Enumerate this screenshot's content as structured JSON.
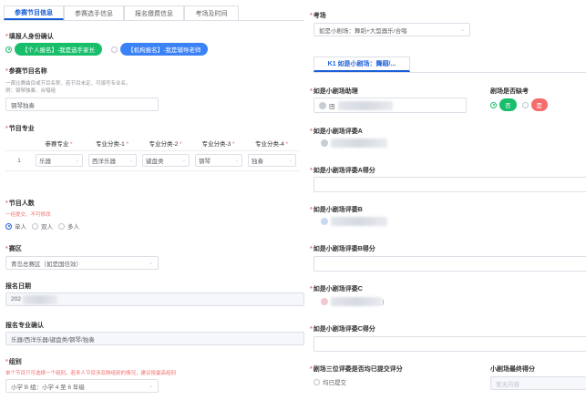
{
  "tabs": [
    {
      "label": "参赛节目信息",
      "active": true
    },
    {
      "label": "参赛选手信息"
    },
    {
      "label": "报名缴费信息"
    },
    {
      "label": "考场及时间"
    }
  ],
  "identity": {
    "label": "填报人身份确认",
    "options": [
      {
        "label": "【个人报名】-我是选手家长",
        "color": "#19be6b",
        "selected": true
      },
      {
        "label": "【机构报名】-我是辅导老师",
        "color": "#3b82f6",
        "selected": false
      }
    ]
  },
  "program_name": {
    "label": "参赛节目名称",
    "hint1": "一首比赛曲目或节目名称、若节目未定、可填写专业名。",
    "hint2": "例：钢琴独奏、合唱组",
    "value": "钢琴独奏"
  },
  "major": {
    "label": "节目专业",
    "columns": [
      "参赛专业",
      "专业分类-1",
      "专业分类-2",
      "专业分类-3",
      "专业分类-4"
    ],
    "row": {
      "index": "1",
      "values": [
        "乐器",
        "西洋乐器",
        "键盘类",
        "钢琴",
        "独奏"
      ]
    }
  },
  "people": {
    "label": "节目人数",
    "warning": "一经提交、不可修改",
    "options": [
      {
        "label": "单人",
        "selected": true
      },
      {
        "label": "双人",
        "selected": false
      },
      {
        "label": "多人",
        "selected": false
      }
    ]
  },
  "region": {
    "label": "赛区",
    "value": "青岛总赛区（如是国信效）"
  },
  "date": {
    "label": "报名日期",
    "value": "202"
  },
  "major_confirm": {
    "label": "报名专业确认",
    "value": "乐器/西洋乐器/键盘类/钢琴/独奏"
  },
  "group": {
    "label": "组别",
    "warning": "单个节目只可选择一个组别，若多人节目涉及跨组别的情况，建议按最高组别",
    "value": "小学 B 组：小学 4 至 6 年级"
  },
  "venue": {
    "label": "考场",
    "value": "如是小剧场：舞蹈+大型器乐/合唱"
  },
  "subtab": {
    "label": "K1 如是小剧场：舞蹈/..."
  },
  "right": {
    "assistant_label": "如是小剧场助理",
    "assistant_value": "田",
    "absent_label": "剧场是否缺考",
    "absent_yes": "是",
    "absent_no": "否",
    "judge_a": "如是小剧场评委A",
    "judge_a_score": "如是小剧场评委A得分",
    "judge_b": "如是小剧场评委B",
    "judge_b_score": "如是小剧场评委B得分",
    "judge_c": "如是小剧场评委C",
    "judge_c_suffix": "）",
    "judge_c_score": "如是小剧场评委C得分",
    "submitted_label": "剧场三位评委是否均已提交评分",
    "submitted_option": "均已提交",
    "final_label": "小剧场最终得分",
    "final_placeholder": "暂无内容"
  },
  "colors": {
    "accent": "#1a5fd8",
    "required": "#f56c6c",
    "green": "#19be6b",
    "red": "#f56c6c"
  }
}
